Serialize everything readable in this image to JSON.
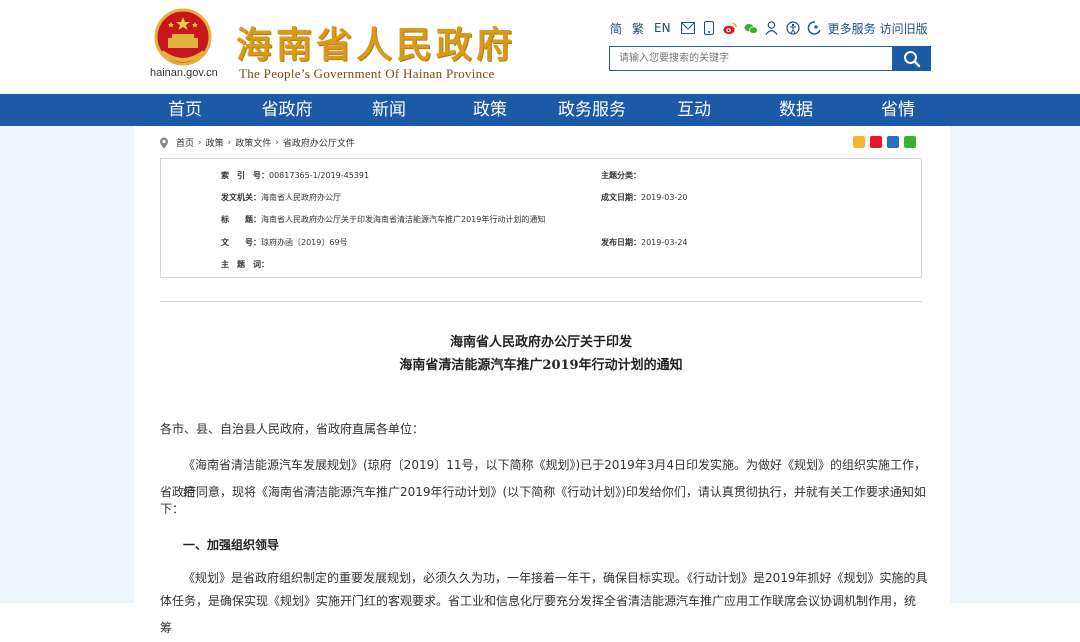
{
  "header": {
    "logo_cn": "海南省人民政府",
    "logo_en": "The People’s Government Of Hainan Province",
    "domain": "hainan.gov.cn",
    "top_links": {
      "simplified": "简",
      "traditional": "繁",
      "english": "EN",
      "more_services": "更多服务",
      "old_version": "访问旧版"
    },
    "search_placeholder": "请输入您要搜索的关键字"
  },
  "nav": [
    "首页",
    "省政府",
    "新闻",
    "政策",
    "政务服务",
    "互动",
    "数据",
    "省情"
  ],
  "breadcrumb": [
    "首页",
    "政策",
    "政策文件",
    "省政府办公厅文件"
  ],
  "meta": {
    "index_label": "索　引　号：",
    "index_value": "00817365-1/2019-45391",
    "topic_label": "主题分类：",
    "topic_value": "",
    "issuer_label": "发文机关：",
    "issuer_value": "海南省人民政府办公厅",
    "created_label": "成文日期：",
    "created_value": "2019-03-20",
    "title_label": "标　　题：",
    "title_value": "海南省人民政府办公厅关于印发海南省清洁能源汽车推广2019年行动计划的通知",
    "docno_label": "文　　号：",
    "docno_value": "琼府办函〔2019〕69号",
    "published_label": "发布日期：",
    "published_value": "2019-03-24",
    "keywords_label": "主　题　词：",
    "keywords_value": ""
  },
  "document": {
    "title_line1": "海南省人民政府办公厅关于印发",
    "title_line2": "海南省清洁能源汽车推广2019年行动计划的通知",
    "salutation": "各市、县、自治县人民政府，省政府直属各单位：",
    "para1_line1": "《海南省清洁能源汽车发展规划》(琼府〔2019〕11号，以下简称《规划》)已于2019年3月4日印发实施。为做好《规划》的组织实施工作，经",
    "para1_line2": "省政府同意，现将《海南省清洁能源汽车推广2019年行动计划》(以下简称《行动计划》)印发给你们，请认真贯彻执行，并就有关工作要求通知如",
    "para1_line3": "下：",
    "section1": "一、加强组织领导",
    "para2_line1": "《规划》是省政府组织制定的重要发展规划，必须久久为功，一年接着一年干，确保目标实现。《行动计划》是2019年抓好《规划》实施的具",
    "para2_line2": "体任务，是确保实现《规划》实施开门红的客观要求。省工业和信息化厅要充分发挥全省清洁能源汽车推广应用工作联席会议协调机制作用，统筹"
  },
  "colors": {
    "nav_bg": "#1b5aa6",
    "logo_gold": "#d99a1b",
    "side_bg": "#eef4fb"
  },
  "icons": [
    "mail-icon",
    "mobile-icon",
    "weibo-icon",
    "wechat-icon",
    "user-icon",
    "accessibility-icon",
    "elder-care-icon",
    "search-icon",
    "location-pin-icon"
  ]
}
